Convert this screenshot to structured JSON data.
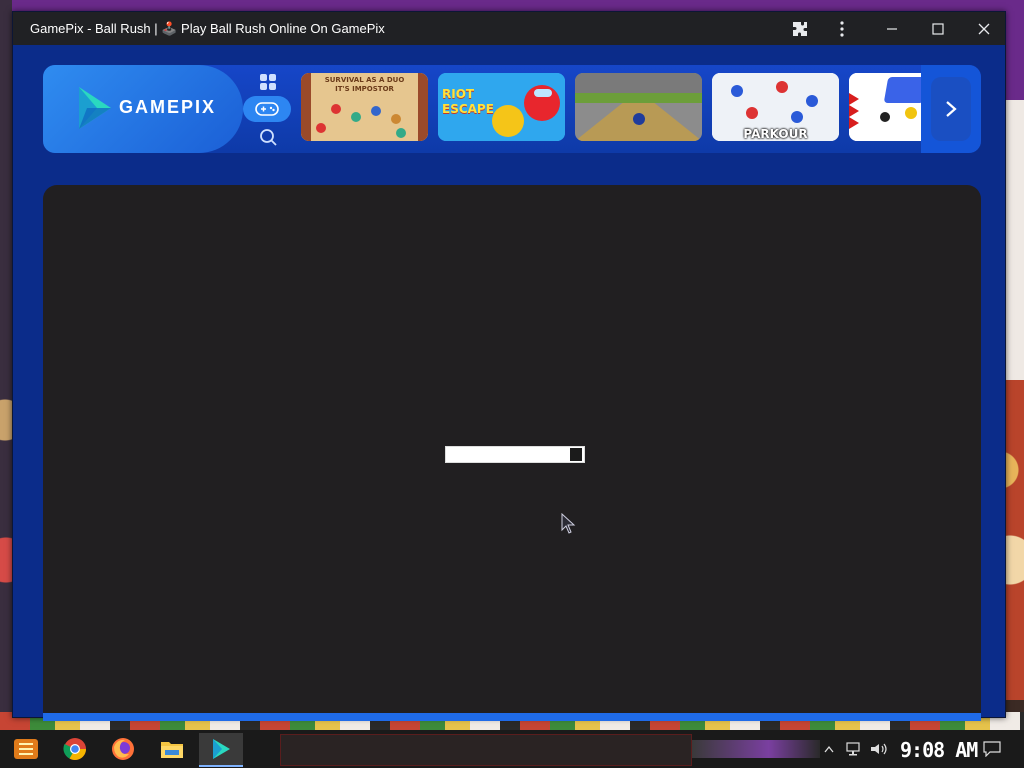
{
  "window": {
    "title": "GamePix - Ball Rush | 🕹️ Play Ball Rush Online On GamePix",
    "controls": {
      "extensions": "extensions-icon",
      "menu": "kebab-menu-icon",
      "minimize": "minimize-icon",
      "maximize": "maximize-icon",
      "close": "close-icon"
    }
  },
  "gamepix": {
    "logo_text": "GAMEPIX",
    "nav": [
      {
        "name": "grid-icon",
        "active": false
      },
      {
        "name": "gamepad-icon",
        "active": true
      },
      {
        "name": "search-icon",
        "active": false
      }
    ],
    "thumbnails": [
      {
        "caption_top": "SURVIVAL AS A DUO",
        "caption_sub": "IT'S IMPOSTOR",
        "bg": "#e9c994"
      },
      {
        "caption_top": "RIOT",
        "caption_sub": "ESCAPE",
        "bg": "#2fa7ee"
      },
      {
        "caption_top": "",
        "caption_sub": "",
        "bg": "#6c8a4a"
      },
      {
        "caption_top": "PARKOUR",
        "caption_sub": "",
        "bg": "#eef2f7"
      },
      {
        "caption_top": "",
        "caption_sub": "",
        "bg": "#ffffff"
      }
    ],
    "next_icon": "chevron-right-icon"
  },
  "game": {
    "loading_progress": 0.92
  },
  "taskbar": {
    "apps": [
      "start-icon",
      "chrome-icon",
      "firefox-icon",
      "file-explorer-icon",
      "gamepix-app-icon"
    ],
    "search_placeholder": "",
    "tray": [
      "chevron-up-icon",
      "network-icon",
      "volume-icon"
    ],
    "clock": "9:08 AM"
  },
  "colors": {
    "brand_blue": "#1646c8",
    "game_bg": "#211f21",
    "titlebar": "#202124"
  }
}
